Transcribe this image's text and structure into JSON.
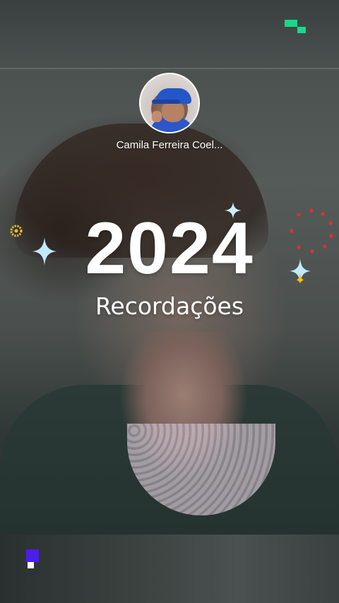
{
  "story": {
    "user_name": "Camila Ferreira Coel...",
    "year": "2024",
    "subtitle": "Recordações"
  },
  "decor": {
    "brand_mark_color": "#18d98a",
    "bottom_mark_color": "#4a1fe8",
    "sparkle_color": "#bfe9ff",
    "yellow_ring_color": "#f2c21b",
    "red_ring_color": "#e0312a",
    "icons": [
      "brand-mark-icon",
      "sparkle-icon",
      "ring-dots-icon",
      "bottom-mark-icon"
    ]
  }
}
